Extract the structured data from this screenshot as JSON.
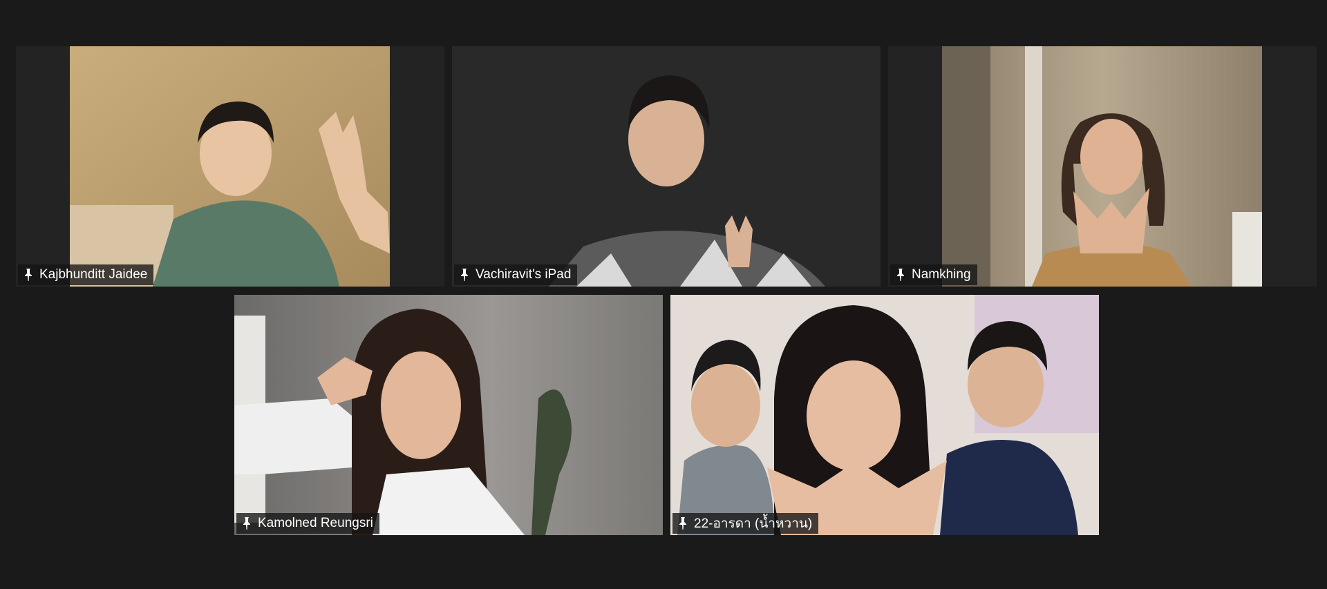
{
  "meeting": {
    "participants": [
      {
        "id": "p1",
        "display_name": "Kajbhunditt Jaidee",
        "icon": "pin-icon"
      },
      {
        "id": "p2",
        "display_name": "Vachiravit's iPad",
        "icon": "pin-icon"
      },
      {
        "id": "p3",
        "display_name": "Namkhing",
        "icon": "pin-icon"
      },
      {
        "id": "p4",
        "display_name": "Kamolned Reungsri",
        "icon": "pin-icon"
      },
      {
        "id": "p5",
        "display_name": "22-อารดา (น้ำหวาน)",
        "icon": "pin-icon"
      }
    ]
  },
  "colors": {
    "background": "#1a1a1a",
    "tile_background": "#232323",
    "name_tag_background": "#141414",
    "name_tag_text": "#ffffff"
  }
}
